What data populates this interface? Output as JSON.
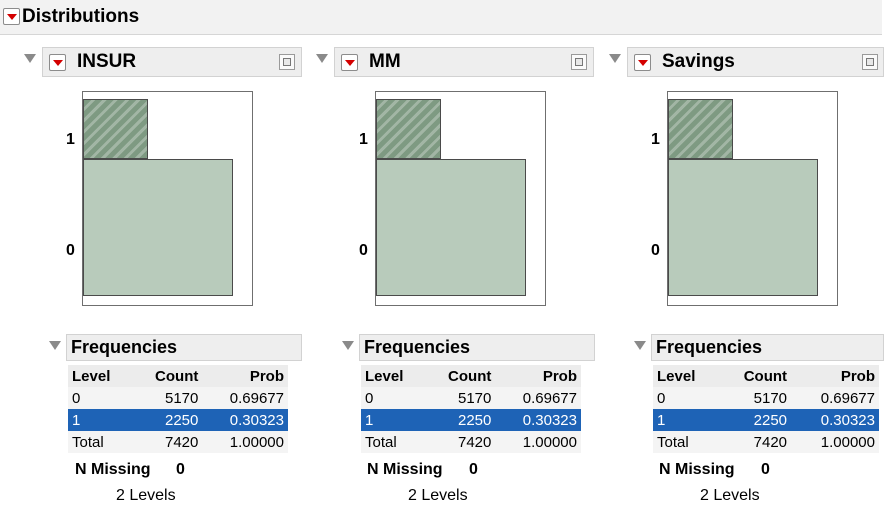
{
  "report": {
    "title": "Distributions"
  },
  "panels": [
    {
      "variable": "INSUR",
      "chart": {
        "levels": [
          "1",
          "0"
        ]
      },
      "frequencies": {
        "title": "Frequencies",
        "headers": [
          "Level",
          "Count",
          "Prob"
        ],
        "rows": [
          {
            "level": "0",
            "count": "5170",
            "prob": "0.69677"
          },
          {
            "level": "1",
            "count": "2250",
            "prob": "0.30323"
          },
          {
            "level": "Total",
            "count": "7420",
            "prob": "1.00000"
          }
        ],
        "n_missing_label": "N Missing",
        "n_missing_value": "0",
        "levels_text": "2 Levels"
      }
    },
    {
      "variable": "MM",
      "chart": {
        "levels": [
          "1",
          "0"
        ]
      },
      "frequencies": {
        "title": "Frequencies",
        "headers": [
          "Level",
          "Count",
          "Prob"
        ],
        "rows": [
          {
            "level": "0",
            "count": "5170",
            "prob": "0.69677"
          },
          {
            "level": "1",
            "count": "2250",
            "prob": "0.30323"
          },
          {
            "level": "Total",
            "count": "7420",
            "prob": "1.00000"
          }
        ],
        "n_missing_label": "N Missing",
        "n_missing_value": "0",
        "levels_text": "2 Levels"
      }
    },
    {
      "variable": "Savings",
      "chart": {
        "levels": [
          "1",
          "0"
        ]
      },
      "frequencies": {
        "title": "Frequencies",
        "headers": [
          "Level",
          "Count",
          "Prob"
        ],
        "rows": [
          {
            "level": "0",
            "count": "5170",
            "prob": "0.69677"
          },
          {
            "level": "1",
            "count": "2250",
            "prob": "0.30323"
          },
          {
            "level": "Total",
            "count": "7420",
            "prob": "1.00000"
          }
        ],
        "n_missing_label": "N Missing",
        "n_missing_value": "0",
        "levels_text": "2 Levels"
      }
    }
  ],
  "colors": {
    "selected_row": "#1e63b6",
    "bar_fill": "#b8cbbb",
    "bar_hatched": "#7e9a82",
    "menu_triangle": "#d40000"
  },
  "chart_data": [
    {
      "type": "bar",
      "orientation": "horizontal",
      "categories": [
        "0",
        "1"
      ],
      "values": [
        5170,
        2250
      ]
    },
    {
      "type": "bar",
      "orientation": "horizontal",
      "categories": [
        "0",
        "1"
      ],
      "values": [
        5170,
        2250
      ]
    },
    {
      "type": "bar",
      "orientation": "horizontal",
      "categories": [
        "0",
        "1"
      ],
      "values": [
        5170,
        2250
      ]
    }
  ]
}
